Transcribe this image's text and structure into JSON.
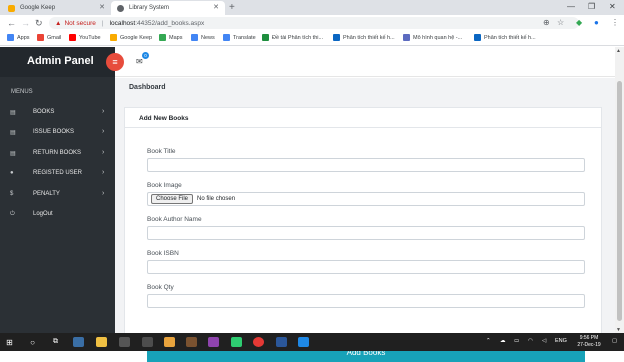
{
  "browser": {
    "tabs": [
      {
        "title": "Google Keep",
        "favicon_color": "#f9ab00"
      },
      {
        "title": "Library System",
        "favicon_color": "#5f6368"
      }
    ],
    "new_tab_symbol": "+",
    "not_secure_label": "Not secure",
    "url_host": "localhost",
    "url_path": ":44352/add_books.aspx",
    "bookmarks": [
      {
        "label": "Apps",
        "color": "#4285f4"
      },
      {
        "label": "Gmail",
        "color": "#ea4335"
      },
      {
        "label": "YouTube",
        "color": "#ff0000"
      },
      {
        "label": "Google Keep",
        "color": "#f9ab00"
      },
      {
        "label": "Maps",
        "color": "#34a853"
      },
      {
        "label": "News",
        "color": "#4285f4"
      },
      {
        "label": "Translate",
        "color": "#4285f4"
      },
      {
        "label": "Đề tài Phân tích thi...",
        "color": "#1e8e3e"
      },
      {
        "label": "Phân tích thiết kế h...",
        "color": "#0a66c2"
      },
      {
        "label": "Mô hình quan hệ -...",
        "color": "#5c6bc0"
      },
      {
        "label": "Phân tích thiết kế h...",
        "color": "#0a66c2"
      }
    ]
  },
  "sidebar": {
    "brand": "Admin Panel",
    "menus_label": "MENUS",
    "items": [
      {
        "label": "BOOKS",
        "icon": "book-icon",
        "glyph": "▤",
        "chevron": "›"
      },
      {
        "label": "ISSUE BOOKS",
        "icon": "book-icon",
        "glyph": "▤",
        "chevron": "›"
      },
      {
        "label": "RETURN BOOKS",
        "icon": "book-icon",
        "glyph": "▤",
        "chevron": "›"
      },
      {
        "label": "REGISTED USER",
        "icon": "user-icon",
        "glyph": "●",
        "chevron": "›"
      },
      {
        "label": "PENALTY",
        "icon": "dollar-icon",
        "glyph": "$",
        "chevron": "›"
      },
      {
        "label": "LogOut",
        "icon": "power-icon",
        "glyph": "⏻",
        "chevron": ""
      }
    ]
  },
  "topbar": {
    "mail_badge": "0"
  },
  "main": {
    "page_title": "Dashboard",
    "card_title": "Add New Books",
    "fields": {
      "title_label": "Book Title",
      "image_label": "Book Image",
      "file_button": "Choose File",
      "file_status": "No file chosen",
      "author_label": "Book Author Name",
      "isbn_label": "Book ISBN",
      "qty_label": "Book Qty"
    },
    "submit_label": "Add Books",
    "accent_color": "#17a2b8"
  },
  "taskbar": {
    "language": "ENG",
    "time": "9:56 PM",
    "date": "27-Dec-19"
  }
}
